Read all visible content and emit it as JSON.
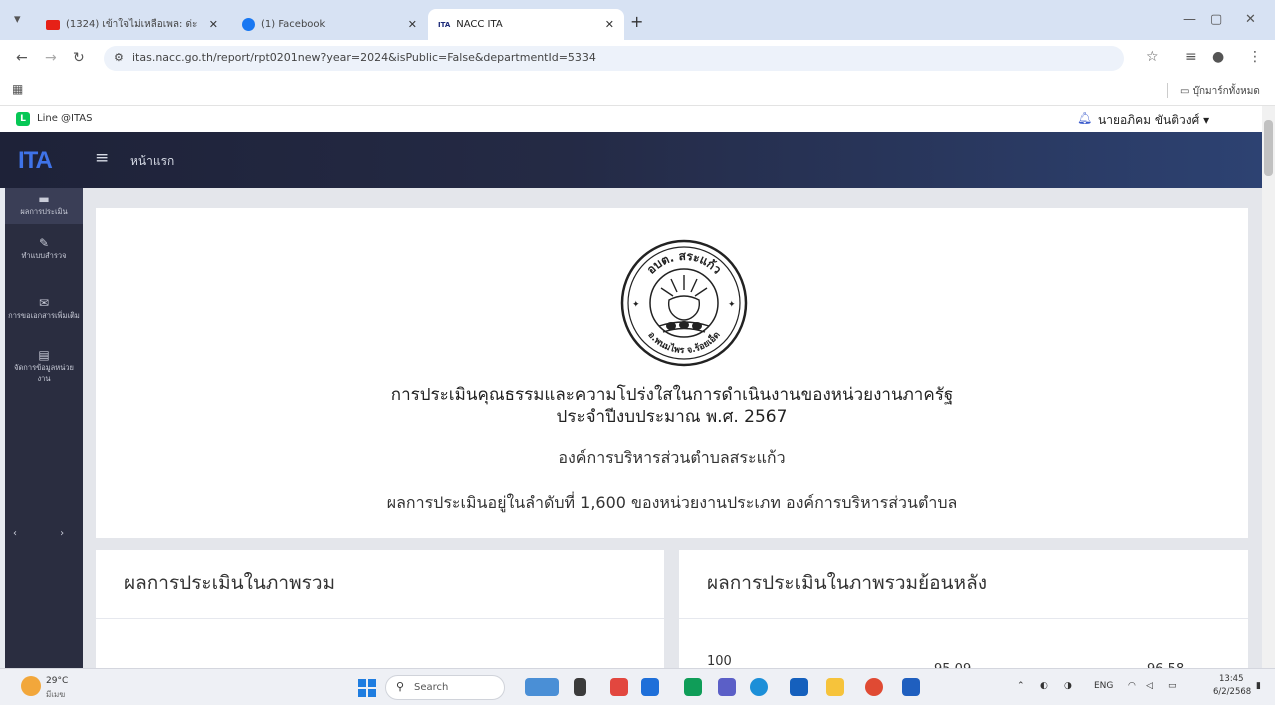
{
  "browser": {
    "tabs": [
      {
        "label": "(1324) เข้าใจไม่เหลือเพล: ด่ะ",
        "icon": "youtube-icon",
        "active": false
      },
      {
        "label": "(1) Facebook",
        "icon": "facebook-icon",
        "active": false
      },
      {
        "label": "NACC ITA",
        "icon": "ita-favicon",
        "active": true
      }
    ],
    "tab_favicon_text": "ITA",
    "url": "itas.nacc.go.th/report/rpt0201new?year=2024&isPublic=False&departmentId=5334",
    "bookmark_folder": "บุ๊กมาร์กทั้งหมด"
  },
  "site": {
    "line_label": "Line @ITAS",
    "user_name": "นายอภิคม ขันติวงศ์ ▾",
    "logo_text": "ITA",
    "home_label": "หน้าแรก",
    "sidebar": [
      {
        "label": "ผลการประเมิน",
        "icon": "chart-icon"
      },
      {
        "label": "ทำแบบสำรวจ",
        "icon": "survey-icon"
      },
      {
        "label": "การขอเอกสารเพิ่มเติม",
        "icon": "mail-icon"
      },
      {
        "label": "จัดการข้อมูลหน่วยงาน",
        "icon": "document-icon"
      }
    ],
    "sidebar_pager": "‹ ›"
  },
  "report": {
    "seal_text_top": "อบต. สระแก้ว",
    "seal_text_bottom": "อ.พนมไพร จ.ร้อยเอ็ด",
    "title": "การประเมินคุณธรรมและความโปร่งใสในการดำเนินงานของหน่วยงานภาครัฐ",
    "fiscal_year": "ประจำปีงบประมาณ พ.ศ. 2567",
    "organization": "องค์การบริหารส่วนตำบลสระแก้ว",
    "ranking": "ผลการประเมินอยู่ในลำดับที่ 1,600 ของหน่วยงานประเภท องค์การบริหารส่วนตำบล",
    "overall_title": "ผลการประเมินในภาพรวม",
    "history_title": "ผลการประเมินในภาพรวมย้อนหลัง",
    "history_axis_max": "100",
    "history_value_a": "95.09",
    "history_value_b": "96.58"
  },
  "taskbar": {
    "weather_temp": "29°C",
    "weather_cond": "มีเมฆ",
    "search_label": "Search",
    "lang": "ENG",
    "time": "13:45",
    "date": "6/2/2568"
  }
}
